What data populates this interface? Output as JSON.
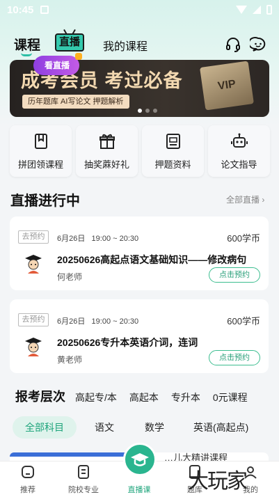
{
  "status_bar": {
    "time": "10:45"
  },
  "header": {
    "tab_courses": "课程",
    "tab_live": "直播",
    "tab_my_courses": "我的课程",
    "icons": [
      "headset-icon",
      "chat-icon"
    ]
  },
  "banner": {
    "headline": "成考会员 考过必备",
    "sub_tags": "历年题库  AI写论文  押题解析",
    "badge": "VIP",
    "live_pill": "看直播"
  },
  "quick_links": [
    {
      "label": "拼团领课程",
      "icon": "bookmark-icon"
    },
    {
      "label": "抽奖蔴好礼",
      "icon": "gift-icon"
    },
    {
      "label": "押题资料",
      "icon": "document-icon"
    },
    {
      "label": "论文指导",
      "icon": "robot-icon"
    }
  ],
  "live_section": {
    "title": "直播进行中",
    "all_link": "全部直播"
  },
  "live_cards": [
    {
      "reserve_tag": "去预约",
      "date": "6月26日",
      "time": "19:00 ~ 20:30",
      "price": "600学币",
      "title": "20250626高起点语文基础知识——修改病句",
      "teacher": "何老师",
      "button": "点击预约"
    },
    {
      "reserve_tag": "去预约",
      "date": "6月26日",
      "time": "19:00 ~ 20:30",
      "price": "600学币",
      "title": "20250626专升本英语介词，连词",
      "teacher": "黄老师",
      "button": "点击预约"
    }
  ],
  "levels": {
    "title": "报考层次",
    "options": [
      "高起专/本",
      "高起本",
      "专升本",
      "0元课程"
    ]
  },
  "subjects": {
    "options": [
      "全部科目",
      "语文",
      "数学",
      "英语(高起点)"
    ],
    "selected": "全部科目"
  },
  "peek": {
    "text": "…儿大精讲课程"
  },
  "bottom_nav": [
    {
      "label": "推荐",
      "icon": "home-icon"
    },
    {
      "label": "院校专业",
      "icon": "list-icon"
    },
    {
      "label": "直播课",
      "icon": "graduation-cap-icon"
    },
    {
      "label": "题库",
      "icon": "question-bank-icon"
    },
    {
      "label": "我的",
      "icon": "user-icon"
    }
  ],
  "watermark": "大玩家",
  "colors": {
    "accent": "#2ab58f",
    "accent_text": "#1fa57c",
    "live_pill": "#a24fe3"
  }
}
